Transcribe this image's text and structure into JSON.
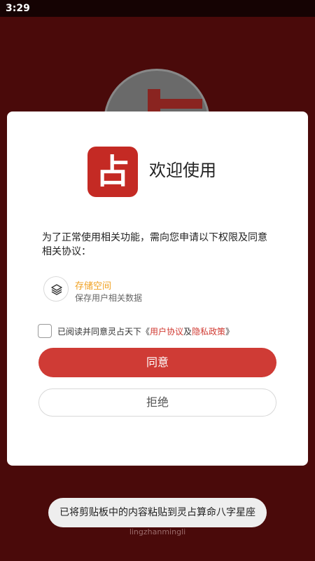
{
  "status_bar": {
    "time": "3:29"
  },
  "background": {
    "watermark": "lingzhanmingli"
  },
  "dialog": {
    "logo_char": "占",
    "title": "欢迎使用",
    "intro": "为了正常使用相关功能，需向您申请以下权限及同意相关协议：",
    "permission": {
      "icon": "layers-icon",
      "title": "存储空间",
      "description": "保存用户相关数据"
    },
    "agreement": {
      "checked": false,
      "prefix": "已阅读并同意灵占天下《",
      "user_agreement": "用户协议",
      "middle": "及",
      "privacy_policy": "隐私政策",
      "suffix": "》"
    },
    "agree_button": "同意",
    "reject_button": "拒绝"
  },
  "toast": {
    "text": "已将剪贴板中的内容粘贴到灵占算命八字星座"
  },
  "colors": {
    "background": "#4a0a0a",
    "accent": "#cf3b35",
    "permission_title": "#f0a020",
    "link": "#d03a32"
  }
}
